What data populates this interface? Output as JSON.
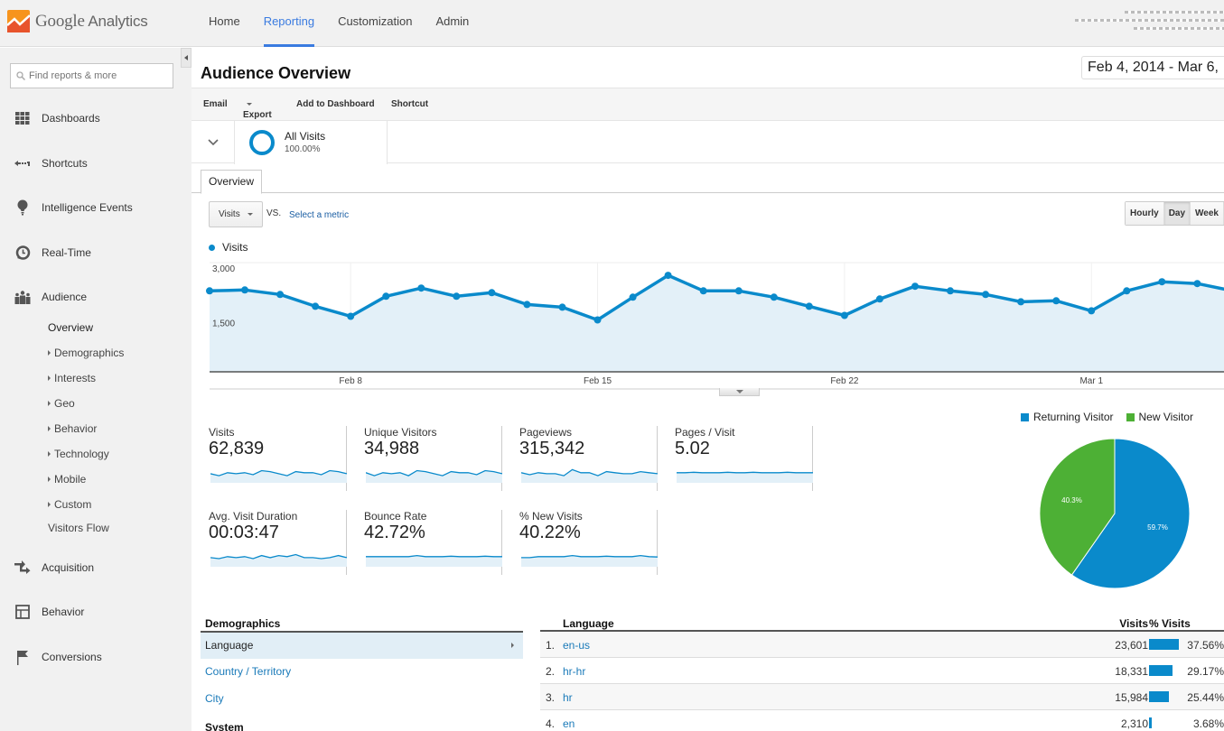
{
  "app": {
    "logo_text_1": "Google",
    "logo_text_2": "Analytics",
    "nav": [
      {
        "label": "Home",
        "active": false
      },
      {
        "label": "Reporting",
        "active": true
      },
      {
        "label": "Customization",
        "active": false
      },
      {
        "label": "Admin",
        "active": false
      }
    ]
  },
  "sidebar": {
    "search_placeholder": "Find reports & more",
    "items": [
      {
        "label": "Dashboards",
        "icon": "dashboard-grid-icon"
      },
      {
        "label": "Shortcuts",
        "icon": "shortcut-arrow-icon"
      },
      {
        "label": "Intelligence Events",
        "icon": "lightbulb-icon"
      },
      {
        "label": "Real-Time",
        "icon": "clock-icon"
      },
      {
        "label": "Audience",
        "icon": "people-icon"
      },
      {
        "label": "Acquisition",
        "icon": "acquisition-arrows-icon"
      },
      {
        "label": "Behavior",
        "icon": "layout-icon"
      },
      {
        "label": "Conversions",
        "icon": "flag-icon"
      }
    ],
    "audience_sub": [
      {
        "label": "Overview",
        "expandable": false,
        "current": true
      },
      {
        "label": "Demographics",
        "expandable": true
      },
      {
        "label": "Interests",
        "expandable": true
      },
      {
        "label": "Geo",
        "expandable": true
      },
      {
        "label": "Behavior",
        "expandable": true
      },
      {
        "label": "Technology",
        "expandable": true
      },
      {
        "label": "Mobile",
        "expandable": true
      },
      {
        "label": "Custom",
        "expandable": true
      },
      {
        "label": "Visitors Flow",
        "expandable": false
      }
    ]
  },
  "report": {
    "title": "Audience Overview",
    "date_range": "Feb 4, 2014 - Mar 6,",
    "actions": {
      "email": "Email",
      "export": "Export",
      "add_to_dashboard": "Add to Dashboard",
      "shortcut": "Shortcut"
    },
    "segment": {
      "name": "All Visits",
      "percent": "100.00%"
    },
    "tab": "Overview",
    "metric_select": "Visits",
    "vs_label": "VS.",
    "select_metric": "Select a metric",
    "granularity": [
      {
        "label": "Hourly",
        "selected": false
      },
      {
        "label": "Day",
        "selected": true
      },
      {
        "label": "Week",
        "selected": false
      }
    ]
  },
  "colors": {
    "primary_blue": "#0a8acb",
    "new_visitor_green": "#4db035",
    "link_blue": "#1a7ab9",
    "nav_active": "#3a7be0"
  },
  "chart_data": [
    {
      "type": "area",
      "title": "",
      "legend": [
        "Visits"
      ],
      "legend_position": "top-left",
      "ylim": [
        0,
        3000
      ],
      "y_ticks": [
        "3,000",
        "1,500"
      ],
      "x_tick_labels": [
        {
          "label": "Feb 8",
          "index": 4
        },
        {
          "label": "Feb 15",
          "index": 11
        },
        {
          "label": "Feb 22",
          "index": 18
        },
        {
          "label": "Mar 1",
          "index": 25
        }
      ],
      "x": [
        "Feb 4",
        "Feb 5",
        "Feb 6",
        "Feb 7",
        "Feb 8",
        "Feb 9",
        "Feb 10",
        "Feb 11",
        "Feb 12",
        "Feb 13",
        "Feb 14",
        "Feb 15",
        "Feb 16",
        "Feb 17",
        "Feb 18",
        "Feb 19",
        "Feb 20",
        "Feb 21",
        "Feb 22",
        "Feb 23",
        "Feb 24",
        "Feb 25",
        "Feb 26",
        "Feb 27",
        "Feb 28",
        "Mar 1",
        "Mar 2",
        "Mar 3",
        "Mar 4",
        "Mar 5"
      ],
      "series": [
        {
          "name": "Visits",
          "values": [
            2225,
            2250,
            2125,
            1800,
            1525,
            2075,
            2300,
            2075,
            2175,
            1850,
            1775,
            1425,
            2050,
            2650,
            2225,
            2225,
            2050,
            1800,
            1550,
            2000,
            2350,
            2225,
            2125,
            1925,
            1950,
            1675,
            2225,
            2475,
            2425,
            2225
          ]
        }
      ],
      "grid": true
    },
    {
      "type": "pie",
      "legend": [
        "Returning Visitor",
        "New Visitor"
      ],
      "legend_position": "top",
      "slices": [
        {
          "label": "Returning Visitor",
          "value": 59.7,
          "display": "59.7%"
        },
        {
          "label": "New Visitor",
          "value": 40.3,
          "display": "40.3%"
        }
      ]
    }
  ],
  "scorecards": [
    {
      "label": "Visits",
      "value": "62,839",
      "spark": [
        0.45,
        0.35,
        0.5,
        0.45,
        0.5,
        0.4,
        0.6,
        0.55,
        0.45,
        0.35,
        0.55,
        0.5,
        0.5,
        0.4,
        0.6,
        0.55,
        0.45
      ]
    },
    {
      "label": "Unique Visitors",
      "value": "34,988",
      "spark": [
        0.5,
        0.35,
        0.5,
        0.45,
        0.5,
        0.35,
        0.6,
        0.55,
        0.45,
        0.35,
        0.55,
        0.5,
        0.5,
        0.4,
        0.6,
        0.55,
        0.45
      ]
    },
    {
      "label": "Pageviews",
      "value": "315,342",
      "spark": [
        0.5,
        0.4,
        0.5,
        0.45,
        0.45,
        0.35,
        0.65,
        0.5,
        0.5,
        0.35,
        0.55,
        0.5,
        0.45,
        0.45,
        0.55,
        0.5,
        0.45
      ]
    },
    {
      "label": "Pages / Visit",
      "value": "5.02",
      "spark": [
        0.5,
        0.5,
        0.52,
        0.5,
        0.5,
        0.5,
        0.52,
        0.5,
        0.5,
        0.52,
        0.5,
        0.5,
        0.5,
        0.52,
        0.5,
        0.5,
        0.5
      ]
    },
    {
      "label": "Avg. Visit Duration",
      "value": "00:03:47",
      "spark": [
        0.45,
        0.4,
        0.5,
        0.45,
        0.5,
        0.4,
        0.55,
        0.45,
        0.55,
        0.5,
        0.6,
        0.45,
        0.45,
        0.4,
        0.45,
        0.55,
        0.45
      ]
    },
    {
      "label": "Bounce Rate",
      "value": "42.72%",
      "spark": [
        0.5,
        0.5,
        0.5,
        0.5,
        0.5,
        0.5,
        0.55,
        0.5,
        0.5,
        0.5,
        0.52,
        0.5,
        0.5,
        0.5,
        0.52,
        0.5,
        0.5
      ]
    },
    {
      "label": "% New Visits",
      "value": "40.22%",
      "spark": [
        0.45,
        0.45,
        0.5,
        0.5,
        0.5,
        0.5,
        0.55,
        0.5,
        0.5,
        0.5,
        0.52,
        0.5,
        0.5,
        0.5,
        0.55,
        0.5,
        0.48
      ]
    }
  ],
  "demographics": {
    "heading": "Demographics",
    "items": [
      {
        "label": "Language",
        "selected": true
      },
      {
        "label": "Country / Territory",
        "selected": false
      },
      {
        "label": "City",
        "selected": false
      }
    ],
    "system_heading": "System"
  },
  "language_table": {
    "headers": {
      "dimension": "Language",
      "visits": "Visits",
      "pct": "% Visits"
    },
    "rows": [
      {
        "rank": "1.",
        "language": "en-us",
        "visits": "23,601",
        "pct": "37.56%",
        "share": 37.56
      },
      {
        "rank": "2.",
        "language": "hr-hr",
        "visits": "18,331",
        "pct": "29.17%",
        "share": 29.17
      },
      {
        "rank": "3.",
        "language": "hr",
        "visits": "15,984",
        "pct": "25.44%",
        "share": 25.44
      },
      {
        "rank": "4.",
        "language": "en",
        "visits": "2,310",
        "pct": "3.68%",
        "share": 3.68
      }
    ]
  }
}
